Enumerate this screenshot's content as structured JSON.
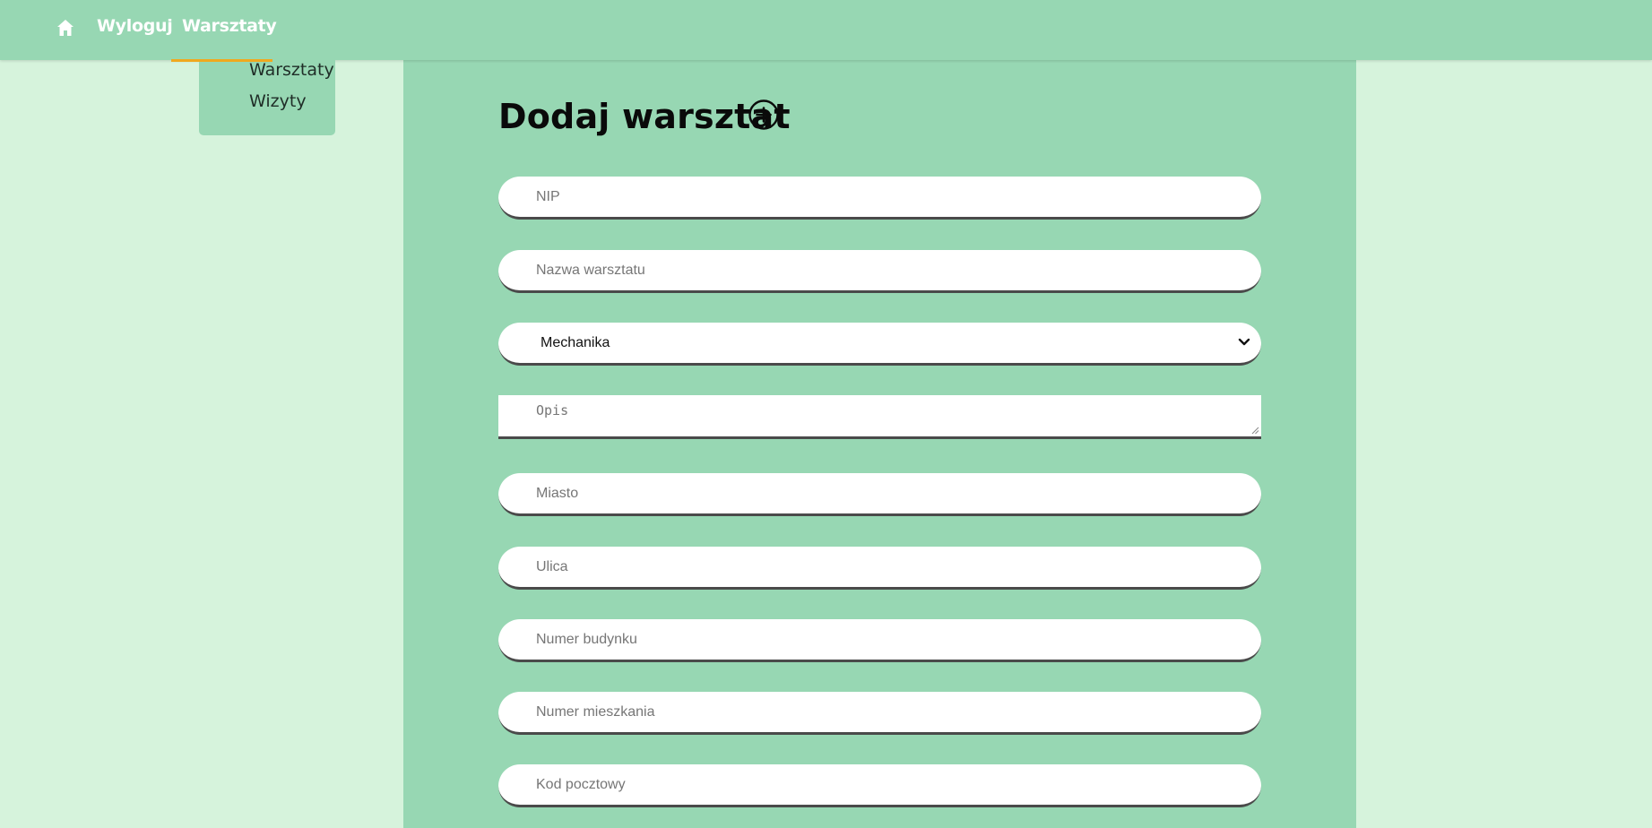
{
  "nav": {
    "home_icon": "home-icon",
    "logout_label": "Wyloguj",
    "warsztaty_label": "Warsztaty",
    "accent_color": "#f0a81e"
  },
  "dropdown": {
    "items": [
      {
        "label": "Warsztaty"
      },
      {
        "label": "Wizyty"
      }
    ]
  },
  "form": {
    "title": "Dodaj warsztat",
    "add_icon": "plus-circle-icon",
    "nip_placeholder": "NIP",
    "name_placeholder": "Nazwa warsztatu",
    "category_value": "Mechanika",
    "description_placeholder": "Opis",
    "city_placeholder": "Miasto",
    "street_placeholder": "Ulica",
    "building_placeholder": "Numer budynku",
    "apartment_placeholder": "Numer mieszkania",
    "postal_placeholder": "Kod pocztowy"
  },
  "colors": {
    "page_bg": "#d6f3dc",
    "panel_bg": "#97d7b3"
  }
}
